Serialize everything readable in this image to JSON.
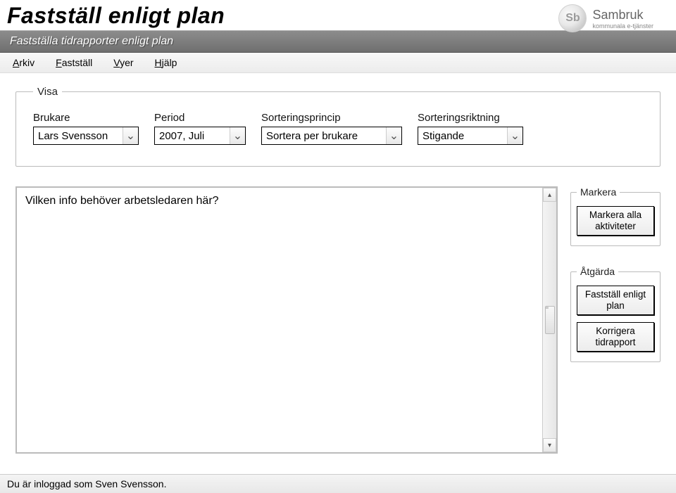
{
  "page_title": "Fastställ enligt plan",
  "window_title": "Fastställa tidrapporter enligt plan",
  "logo": {
    "initials": "Sb",
    "brand": "Sambruk",
    "tagline": "kommunala e-tjänster"
  },
  "menubar": {
    "arkiv": {
      "hotkey": "A",
      "rest": "rkiv"
    },
    "faststall": {
      "hotkey": "F",
      "rest": "astställ"
    },
    "vyer": {
      "hotkey": "V",
      "rest": "yer"
    },
    "hjalp": {
      "hotkey": "H",
      "rest": "jälp"
    }
  },
  "visa": {
    "legend": "Visa",
    "brukare": {
      "label": "Brukare",
      "value": "Lars Svensson"
    },
    "period": {
      "label": "Period",
      "value": "2007, Juli"
    },
    "sorteringsprincip": {
      "label": "Sorteringsprincip",
      "value": "Sortera per brukare"
    },
    "sorteringsriktning": {
      "label": "Sorteringsriktning",
      "value": "Stigande"
    }
  },
  "main_panel_text": "Vilken info behöver arbetsledaren här?",
  "side": {
    "markera": {
      "legend": "Markera",
      "markera_alla": "Markera alla aktiviteter"
    },
    "atgarda": {
      "legend": "Åtgärda",
      "faststall": "Fastställ enligt plan",
      "korrigera": "Korrigera tidrapport"
    }
  },
  "status_text": "Du är inloggad som Sven Svensson."
}
